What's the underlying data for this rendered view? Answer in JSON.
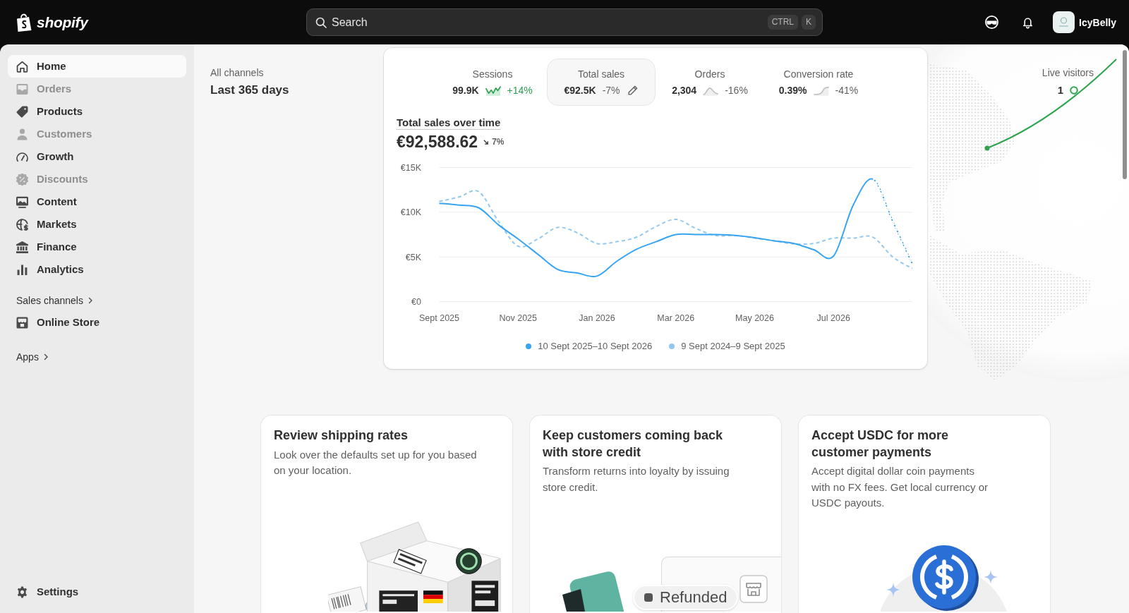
{
  "top_bar": {
    "logo_text": "shopify",
    "search": {
      "placeholder": "Search",
      "shortcut": [
        "CTRL",
        "K"
      ]
    },
    "store_name": "IcyBelly"
  },
  "sidebar": {
    "items": [
      {
        "label": "Home",
        "selected": true,
        "disabled": false
      },
      {
        "label": "Orders",
        "selected": false,
        "disabled": true
      },
      {
        "label": "Products",
        "selected": false,
        "disabled": false
      },
      {
        "label": "Customers",
        "selected": false,
        "disabled": true
      },
      {
        "label": "Growth",
        "selected": false,
        "disabled": false
      },
      {
        "label": "Discounts",
        "selected": false,
        "disabled": true
      },
      {
        "label": "Content",
        "selected": false,
        "disabled": false
      },
      {
        "label": "Markets",
        "selected": false,
        "disabled": false
      },
      {
        "label": "Finance",
        "selected": false,
        "disabled": false
      },
      {
        "label": "Analytics",
        "selected": false,
        "disabled": false
      }
    ],
    "sections": [
      {
        "title": "Sales channels",
        "items": [
          {
            "label": "Online Store",
            "selected": false,
            "disabled": false
          }
        ]
      },
      {
        "title": "Apps"
      }
    ],
    "settings": {
      "label": "Settings",
      "selected": false
    }
  },
  "filters": {
    "channel": "All channels",
    "period": "Last 365 days"
  },
  "metrics": [
    {
      "label": "Sessions",
      "value": "99.9K",
      "change": "+14%",
      "positive": true,
      "selected": false
    },
    {
      "label": "Total sales",
      "value": "€92.5K",
      "change": "-7%",
      "positive": false,
      "selected": true
    },
    {
      "label": "Orders",
      "value": "2,304",
      "change": "-16%",
      "positive": false,
      "selected": false
    },
    {
      "label": "Conversion rate",
      "value": "0.39%",
      "change": "-41%",
      "positive": false,
      "selected": false
    }
  ],
  "chart": {
    "title": "Total sales over time",
    "total": "€92,588.62",
    "change": "7%",
    "positive": false,
    "chart_data": {
      "type": "line",
      "categories": [
        "Sept 2025",
        null,
        null,
        null,
        "Nov 2025",
        null,
        null,
        null,
        "Jan 2026",
        null,
        null,
        null,
        "Mar 2026",
        null,
        null,
        null,
        "May 2026",
        null,
        null,
        null,
        "Jul 2026",
        null,
        null,
        null,
        null
      ],
      "ylim": [
        0,
        15000
      ],
      "yticks": [
        {
          "value": 0,
          "label": "€0"
        },
        {
          "value": 5000,
          "label": "€5K"
        },
        {
          "value": 10000,
          "label": "€10K"
        },
        {
          "value": 15000,
          "label": "€15K"
        }
      ],
      "series": [
        {
          "name": "10 Sept 2025–10 Sept 2026",
          "color": "#38a5f1",
          "line_style": "solid",
          "values": [
            11000,
            10800,
            10500,
            8600,
            7000,
            5300,
            3600,
            3200,
            2850,
            4500,
            5850,
            6700,
            7500,
            7500,
            7500,
            7400,
            7150,
            6800,
            6500,
            5800,
            5100,
            10800,
            13700,
            9000,
            4200
          ]
        },
        {
          "name": "9 Sept 2024–9 Sept 2025",
          "color": "#93c9ee",
          "line_style": "dashed",
          "values": [
            11200,
            11700,
            12300,
            9000,
            6200,
            7000,
            8300,
            7700,
            6500,
            6700,
            7200,
            8400,
            9200,
            8200,
            7400,
            7400,
            7100,
            6800,
            6450,
            6500,
            7100,
            7100,
            7200,
            5000,
            3700
          ]
        }
      ]
    }
  },
  "live_visitors": {
    "label": "Live visitors",
    "count": "1"
  },
  "cards": [
    {
      "kind": "box",
      "title": "Review shipping rates",
      "description": "Look over the defaults set up for you based on your location."
    },
    {
      "kind": "refund",
      "title": "Keep customers coming back with store credit",
      "description": "Transform returns into loyalty by issuing store credit.",
      "badge": "Refunded"
    },
    {
      "kind": "coin",
      "title": "Accept USDC for more customer payments",
      "description": "Accept digital dollar coin payments with no FX fees. Get local currency or USDC payouts."
    }
  ]
}
